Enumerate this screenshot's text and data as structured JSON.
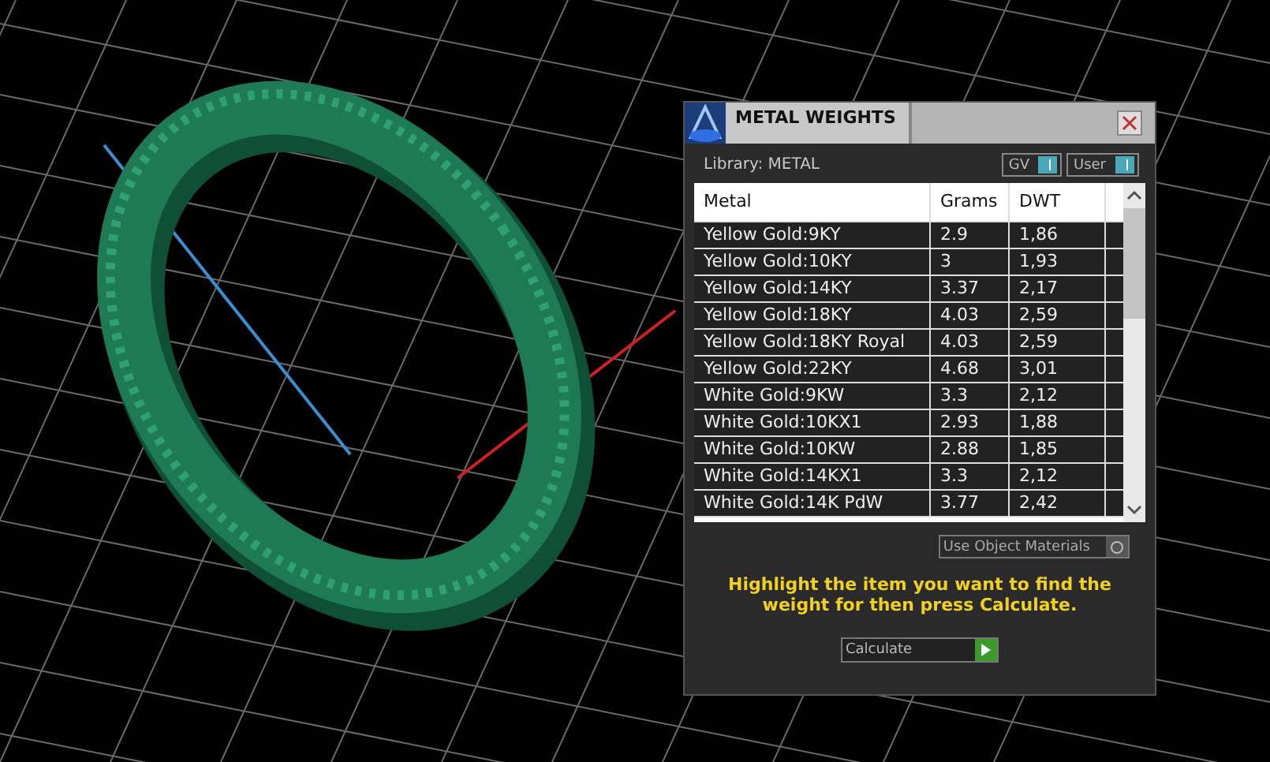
{
  "panel": {
    "title": "METAL WEIGHTS",
    "library_label": "Library: METAL",
    "toggles": [
      {
        "label": "GV",
        "on": true
      },
      {
        "label": "User",
        "on": true
      }
    ],
    "table": {
      "columns": [
        "Metal",
        "Grams",
        "DWT"
      ],
      "rows": [
        {
          "metal": "Yellow Gold:9KY",
          "grams": "2.9",
          "dwt": "1,86"
        },
        {
          "metal": "Yellow Gold:10KY",
          "grams": "3",
          "dwt": "1,93"
        },
        {
          "metal": "Yellow Gold:14KY",
          "grams": "3.37",
          "dwt": "2,17"
        },
        {
          "metal": "Yellow Gold:18KY",
          "grams": "4.03",
          "dwt": "2,59"
        },
        {
          "metal": "Yellow Gold:18KY Royal",
          "grams": "4.03",
          "dwt": "2,59"
        },
        {
          "metal": "Yellow Gold:22KY",
          "grams": "4.68",
          "dwt": "3,01"
        },
        {
          "metal": "White Gold:9KW",
          "grams": "3.3",
          "dwt": "2,12"
        },
        {
          "metal": "White Gold:10KX1",
          "grams": "2.93",
          "dwt": "1,88"
        },
        {
          "metal": "White Gold:10KW",
          "grams": "2.88",
          "dwt": "1,85"
        },
        {
          "metal": "White Gold:14KX1",
          "grams": "3.3",
          "dwt": "2,12"
        },
        {
          "metal": "White Gold:14K PdW",
          "grams": "3.77",
          "dwt": "2,42"
        }
      ]
    },
    "use_object_materials": {
      "label": "Use Object Materials",
      "checked": false
    },
    "hint": "Highlight the item you want to find the weight for then press Calculate.",
    "calculate_button": "Calculate"
  }
}
